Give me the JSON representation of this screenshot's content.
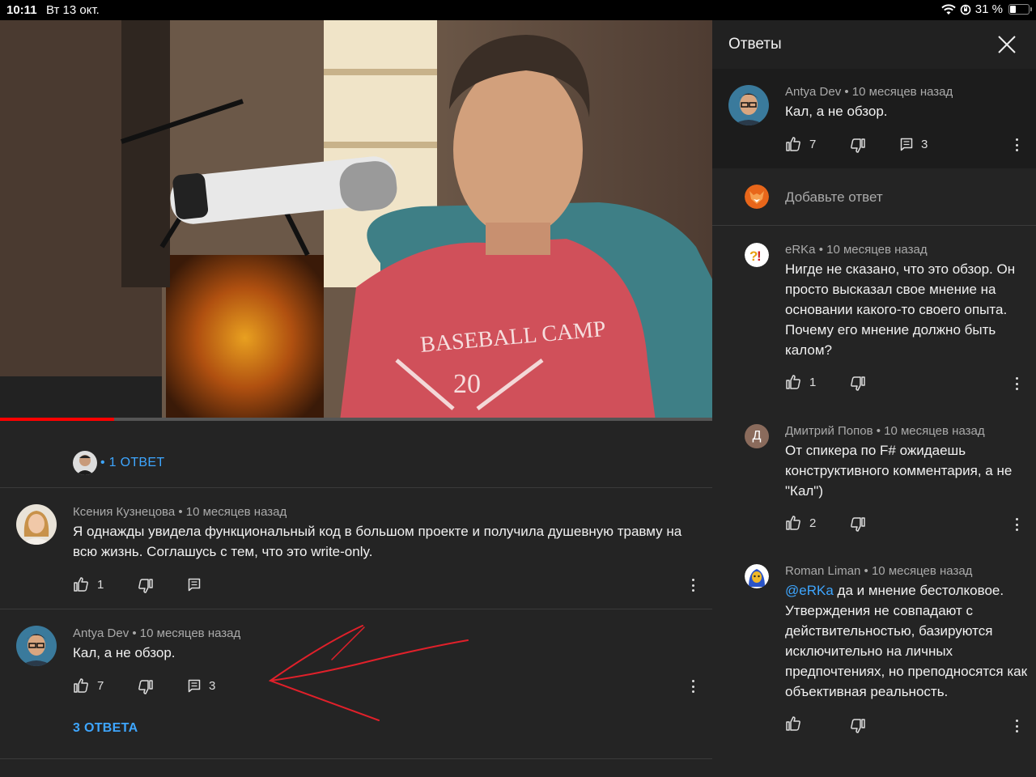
{
  "status_bar": {
    "time": "10:11",
    "date": "Вт 13 окт.",
    "battery": "31 %"
  },
  "video": {
    "progress_fraction": 0.16
  },
  "left": {
    "thread1": {
      "replies_label": "• 1 ОТВЕТ"
    },
    "comment1": {
      "author": "Ксения Кузнецова • 10 месяцев назад",
      "text": "Я однажды увидела функциональный код в большом проекте и получила душевную травму на всю жизнь. Соглашусь с тем, что это write-only.",
      "likes": "1"
    },
    "comment2": {
      "author": "Antya Dev • 10 месяцев назад",
      "text": "Кал, а не обзор.",
      "likes": "7",
      "reply_count": "3",
      "replies_label": "3 ОТВЕТА"
    }
  },
  "right": {
    "header_title": "Ответы",
    "parent": {
      "author": "Antya Dev • 10 месяцев назад",
      "text": "Кал, а не обзор.",
      "likes": "7",
      "reply_count": "3"
    },
    "add_reply_placeholder": "Добавьте ответ",
    "replies": [
      {
        "author": "eRKa • 10 месяцев назад",
        "text": "Нигде не сказано, что это обзор. Он просто высказал свое мнение на основании какого-то своего опыта. Почему его мнение должно быть калом?",
        "likes": "1"
      },
      {
        "author": "Дмитрий Попов • 10 месяцев назад",
        "avatar_letter": "Д",
        "text": "От спикера по F# ожидаешь конструктивного комментария, а не \"Кал\")",
        "likes": "2"
      },
      {
        "author": "Roman Liman • 10 месяцев назад",
        "mention": "@eRKa",
        "text": " да и мнение бестолковое. Утверждения не совпадают с действительностью, базируются исключительно на личных предпочтениях, но преподносятся как объективная реальность.",
        "likes": ""
      }
    ]
  },
  "colors": {
    "accent_link": "#3ea6ff",
    "progress": "#ff0000",
    "panel_bg": "#242424",
    "annotation_arrow": "#e0202a"
  }
}
